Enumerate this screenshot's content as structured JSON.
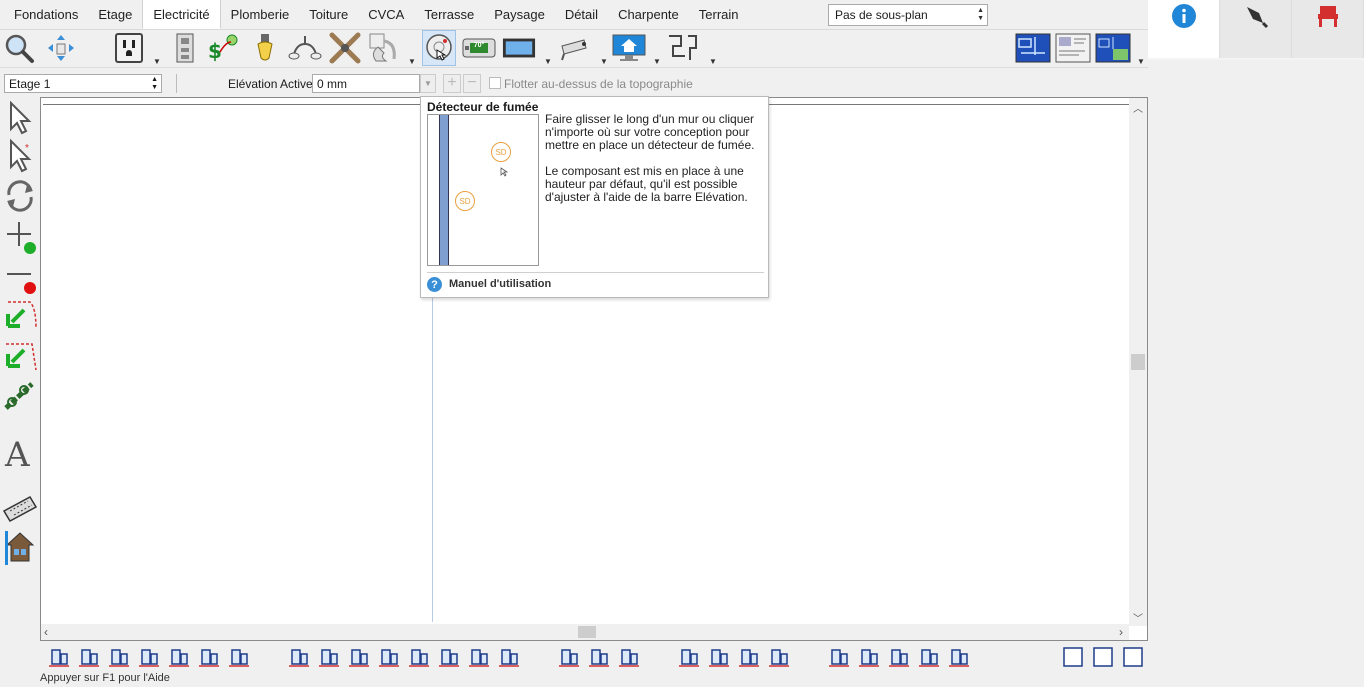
{
  "tabs": [
    "Fondations",
    "Etage",
    "Electricité",
    "Plomberie",
    "Toiture",
    "CVCA",
    "Terrasse",
    "Paysage",
    "Détail",
    "Charpente",
    "Terrain"
  ],
  "active_tab": "Electricité",
  "subplan": {
    "value": "Pas de sous-plan"
  },
  "thermostat_label": "70°",
  "options": {
    "floor": "Etage 1",
    "elevation_label": "Elévation Active:",
    "elevation_value": "0 mm",
    "float_label": "Flotter au-dessus de la topographie"
  },
  "tooltip": {
    "title": "Détecteur de fumée",
    "paragraph1": "Faire glisser le long d'un mur ou cliquer n'importe où sur votre conception pour mettre en place un détecteur de fumée.",
    "paragraph2": "Le composant est mis en place à une hauteur par défaut, qu'il est possible d'ajuster à l'aide de la barre Elévation.",
    "preview_label_1": "SD",
    "preview_label_2": "SD",
    "manual": "Manuel d'utilisation"
  },
  "status": "Appuyer sur F1 pour l'Aide",
  "colors": {
    "accent_blue": "#3a8fd6",
    "detector_orange": "#e8a040",
    "arrow_green": "#1fae2a"
  }
}
